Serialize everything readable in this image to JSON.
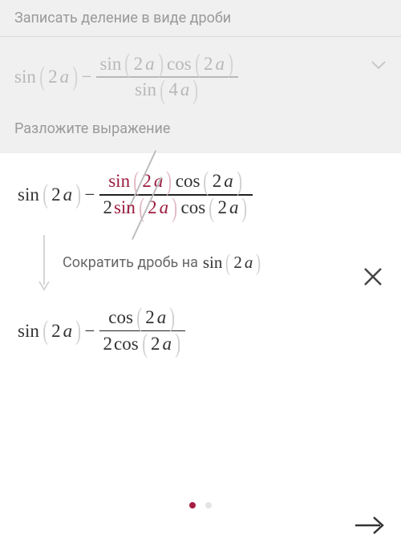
{
  "top": {
    "title1": "Записать деление в виде дроби",
    "title2": "Разложите выражение",
    "expr": {
      "lead_fn": "sin",
      "lead_arg_num": "2",
      "lead_arg_var": "a",
      "minus": "−",
      "num_fn1": "sin",
      "num_arg1_num": "2",
      "num_arg1_var": "a",
      "num_fn2": "cos",
      "num_arg2_num": "2",
      "num_arg2_var": "a",
      "den_fn": "sin",
      "den_arg_num": "4",
      "den_arg_var": "a"
    }
  },
  "detail": {
    "lead_fn": "sin",
    "lead_arg_num": "2",
    "lead_arg_var": "a",
    "minus": "−",
    "num_cancel_fn": "sin",
    "num_cancel_num": "2",
    "num_cancel_var": "a",
    "num_fn2": "cos",
    "num_arg2_num": "2",
    "num_arg2_var": "a",
    "den_coef": "2",
    "den_cancel_fn": "sin",
    "den_cancel_num": "2",
    "den_cancel_var": "a",
    "den_fn2": "cos",
    "den_arg2_num": "2",
    "den_arg2_var": "a"
  },
  "explain": {
    "text": "Сократить дробь на",
    "fn": "sin",
    "arg_num": "2",
    "arg_var": "a"
  },
  "result": {
    "lead_fn": "sin",
    "lead_arg_num": "2",
    "lead_arg_var": "a",
    "minus": "−",
    "num_fn": "cos",
    "num_arg_num": "2",
    "num_arg_var": "a",
    "den_coef": "2",
    "den_fn": "cos",
    "den_arg_num": "2",
    "den_arg_var": "a"
  }
}
